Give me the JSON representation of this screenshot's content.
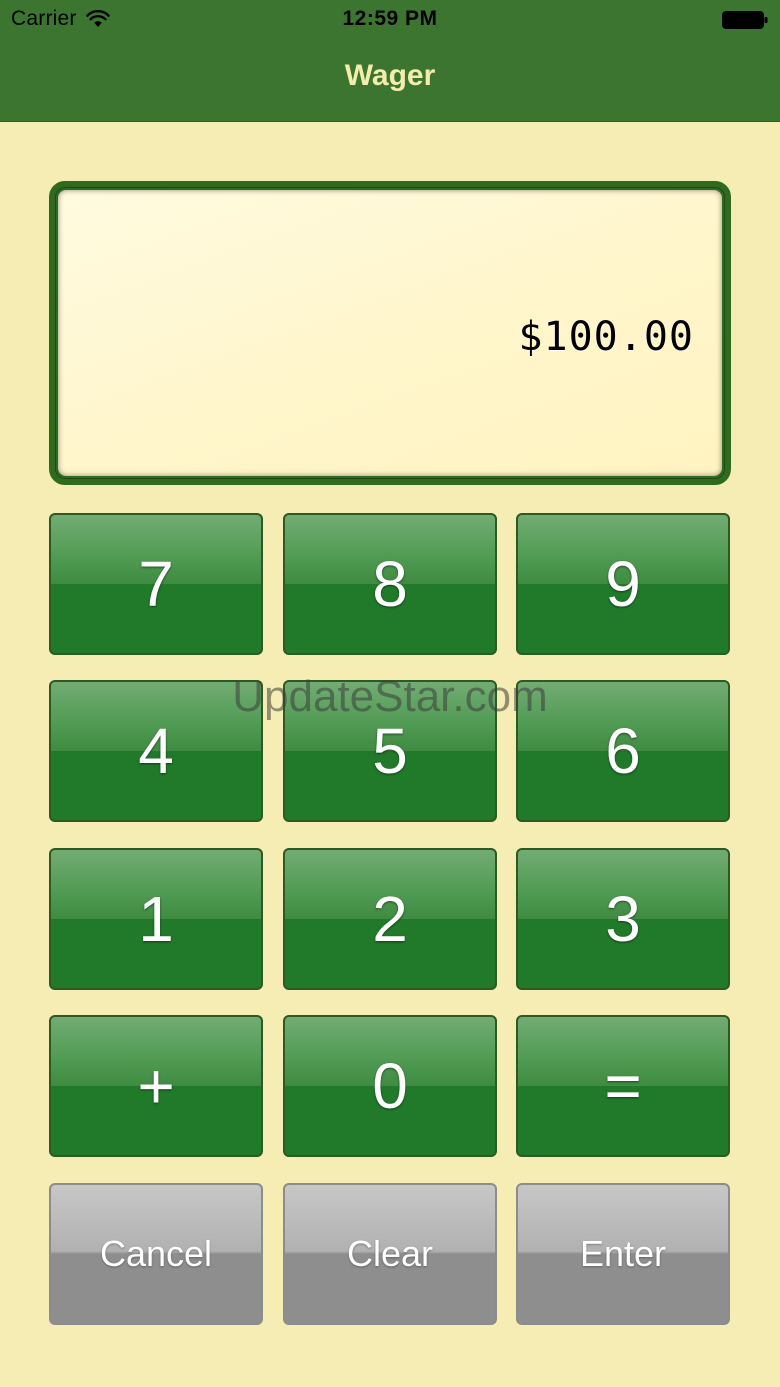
{
  "status_bar": {
    "carrier": "Carrier",
    "time": "12:59 PM"
  },
  "nav": {
    "title": "Wager"
  },
  "display": {
    "value": "$100.00"
  },
  "keypad": {
    "rows": [
      [
        "7",
        "8",
        "9"
      ],
      [
        "4",
        "5",
        "6"
      ],
      [
        "1",
        "2",
        "3"
      ],
      [
        "+",
        "0",
        "="
      ]
    ],
    "actions": [
      "Cancel",
      "Clear",
      "Enter"
    ]
  },
  "watermark": "UpdateStar.com",
  "colors": {
    "nav_bar": "#3b7530",
    "title_text": "#f3ecaa",
    "background": "#f5edb3",
    "key_green": "#217a2a",
    "key_gray": "#8e8e8e",
    "display_frame": "#2f6a1f"
  }
}
